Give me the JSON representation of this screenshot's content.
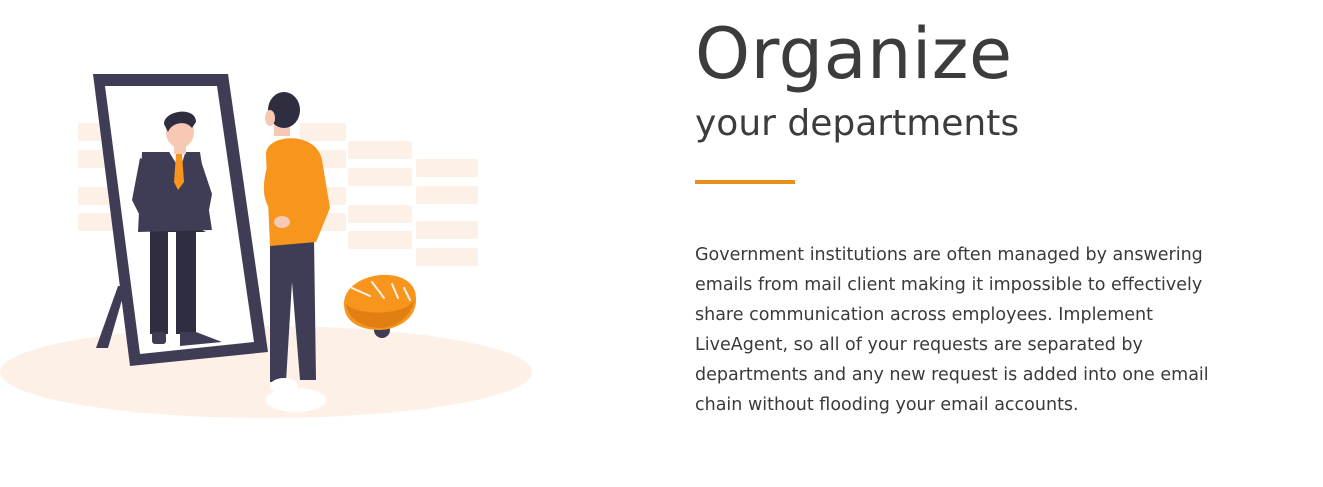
{
  "section": {
    "headline": "Organize",
    "subheadline": "your departments",
    "description": "Government institutions are often managed by answering emails from mail client making it impossible to effectively share communication across employees. Implement LiveAgent, so all of your requests are separated by departments and any new request is added into one email chain without flooding your email accounts.",
    "accent_color": "#e8901c"
  },
  "illustration": {
    "icon": "person-mirror-illustration",
    "colors": {
      "accent": "#f7951d",
      "dark": "#3f3d56",
      "pale": "#fdf0e6"
    }
  }
}
